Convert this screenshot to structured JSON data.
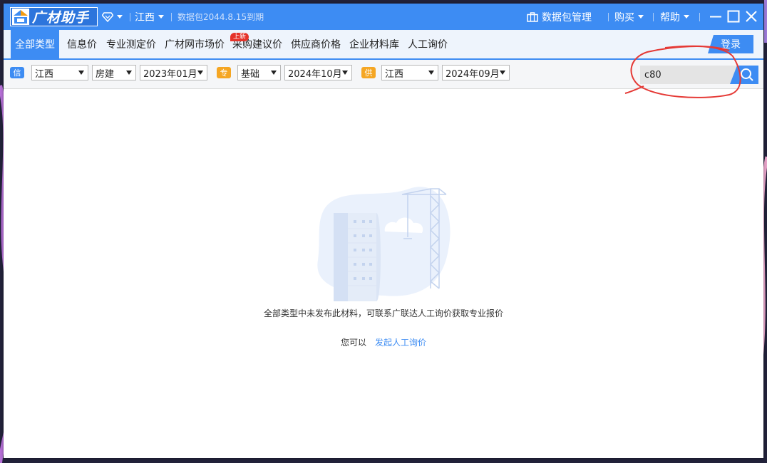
{
  "titlebar": {
    "logo_text": "广材助手",
    "region": "江西",
    "data_package": "数据包2044.8.15到期",
    "package_manage": "数据包管理",
    "buy": "购买",
    "help": "帮助"
  },
  "nav": {
    "tabs": [
      {
        "label": "全部类型",
        "active": true
      },
      {
        "label": "信息价"
      },
      {
        "label": "专业测定价"
      },
      {
        "label": "广材网市场价"
      },
      {
        "label": "采购建议价"
      },
      {
        "label": "供应商价格"
      },
      {
        "label": "企业材料库"
      },
      {
        "label": "人工询价"
      }
    ],
    "new_badge": "上新",
    "login": "登录"
  },
  "filters": {
    "info_tag": "信",
    "info_region": "江西",
    "info_type": "房建",
    "info_date": "2023年01月",
    "pro_tag": "专",
    "pro_type": "基础",
    "pro_date": "2024年10月",
    "sup_tag": "供",
    "sup_region": "江西",
    "sup_date": "2024年09月"
  },
  "search": {
    "value": "c80"
  },
  "empty": {
    "message": "全部类型中未发布此材料，可联系广联达人工询价获取专业报价",
    "prompt": "您可以",
    "action": "发起人工询价"
  },
  "colors": {
    "accent": "#3d8cf3",
    "tag_info": "#3d8cf3",
    "tag_orange": "#f5a623",
    "annotation": "#e53935"
  }
}
